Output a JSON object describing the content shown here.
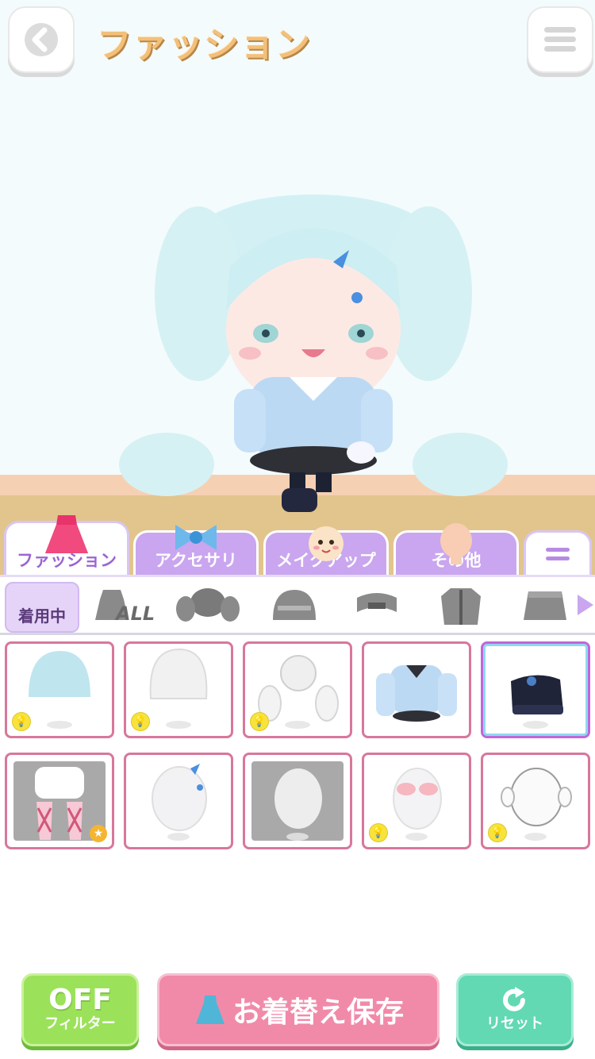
{
  "header": {
    "title": "ファッション",
    "back_icon": "chevron-left-icon",
    "menu_icon": "hamburger-menu-icon"
  },
  "tabs": [
    {
      "label": "ファッション",
      "icon": "dress-icon",
      "active": true
    },
    {
      "label": "アクセサリ",
      "icon": "ribbon-icon",
      "active": false
    },
    {
      "label": "メイクアップ",
      "icon": "face-icon",
      "active": false
    },
    {
      "label": "その他",
      "icon": "silhouette-icon",
      "active": false
    },
    {
      "label": "",
      "icon": "equals-icon",
      "active": false
    }
  ],
  "filter_bar": {
    "wearing_label": "着用中",
    "all_label": "ALL",
    "categories": [
      "all-icon",
      "twin-tail-hair-icon",
      "bob-hair-icon",
      "headband-icon",
      "jacket-icon",
      "skirt-icon"
    ]
  },
  "items": [
    {
      "name": "light-blue-bob-hair",
      "badge": "bulb"
    },
    {
      "name": "white-hair-base",
      "badge": "bulb"
    },
    {
      "name": "curly-twin-tails",
      "badge": "bulb"
    },
    {
      "name": "blue-sailor-outfit",
      "badge": ""
    },
    {
      "name": "black-platform-shoes",
      "badge": "",
      "selected": true
    },
    {
      "name": "pink-fishnet-socks",
      "badge": "star"
    },
    {
      "name": "star-hairpin",
      "badge": ""
    },
    {
      "name": "gray-face-base",
      "badge": ""
    },
    {
      "name": "pink-blush",
      "badge": "bulb"
    },
    {
      "name": "face-outline",
      "badge": "bulb"
    }
  ],
  "buttons": {
    "filter_top": "OFF",
    "filter_bottom": "フィルター",
    "save": "お着替え保存",
    "reset": "リセット"
  },
  "colors": {
    "tab_active": "#9b64d2",
    "tab_inactive": "#c9a6ef",
    "item_border": "#d8779c",
    "save": "#f18aa9",
    "filter": "#9be25a",
    "reset": "#62d9b3"
  }
}
